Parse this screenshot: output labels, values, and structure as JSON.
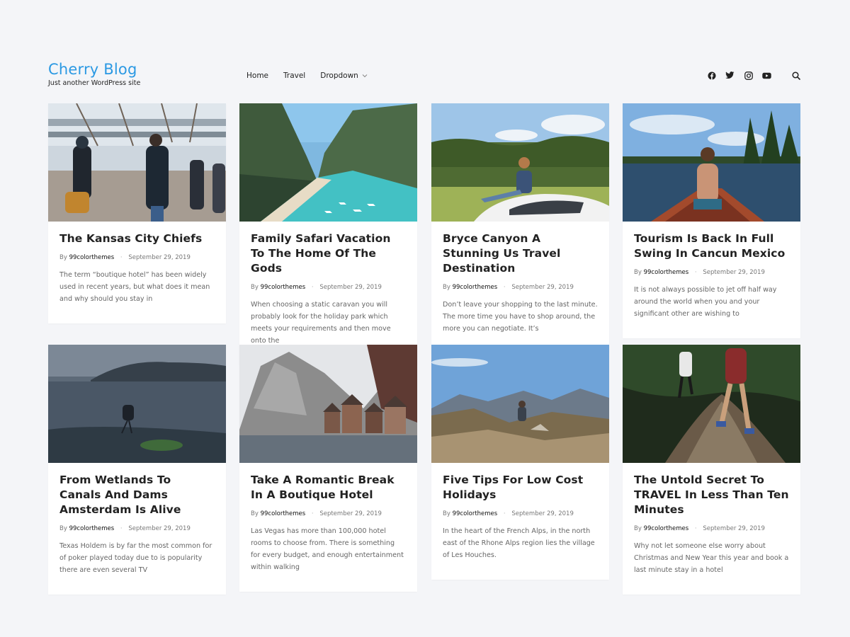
{
  "site": {
    "title": "Cherry Blog",
    "tagline": "Just another WordPress site"
  },
  "nav": {
    "items": [
      "Home",
      "Travel",
      "Dropdown"
    ]
  },
  "social": [
    "facebook-icon",
    "twitter-icon",
    "instagram-icon",
    "youtube-icon",
    "search-icon"
  ],
  "colors": {
    "accent": "#2b99e3",
    "background": "#f4f5f8"
  },
  "posts": [
    {
      "title": "The Kansas City Chiefs",
      "by": "By",
      "author": "99colorthemes",
      "date": "September 29, 2019",
      "excerpt": "The term “boutique hotel” has been widely used in recent years, but what does it mean and why should you stay in"
    },
    {
      "title": "Family Safari Vacation To The Home Of The Gods",
      "by": "By",
      "author": "99colorthemes",
      "date": "September 29, 2019",
      "excerpt": "When choosing a static caravan you will probably look for the holiday park which meets your requirements and then move onto the"
    },
    {
      "title": "Bryce Canyon A Stunning Us Travel Destination",
      "by": "By",
      "author": "99colorthemes",
      "date": "September 29, 2019",
      "excerpt": "Don’t leave your shopping to the last minute. The more time you have to shop around, the more you can negotiate. It’s"
    },
    {
      "title": "Tourism Is Back In Full Swing In Cancun Mexico",
      "by": "By",
      "author": "99colorthemes",
      "date": "September 29, 2019",
      "excerpt": "It is not always possible to jet off half way around the world when you and your significant other are wishing to"
    },
    {
      "title": "From Wetlands To Canals And Dams Amsterdam Is Alive",
      "by": "By",
      "author": "99colorthemes",
      "date": "September 29, 2019",
      "excerpt": "Texas Holdem is by far the most common for of poker played today due to is popularity there are even several TV"
    },
    {
      "title": "Take A Romantic Break In A Boutique Hotel",
      "by": "By",
      "author": "99colorthemes",
      "date": "September 29, 2019",
      "excerpt": "Las Vegas has more than 100,000 hotel rooms to choose from. There is something for every budget, and enough entertainment within walking"
    },
    {
      "title": "Five Tips For Low Cost Holidays",
      "by": "By",
      "author": "99colorthemes",
      "date": "September 29, 2019",
      "excerpt": "In the heart of the French Alps, in the north east of the Rhone Alps region lies the village of Les Houches."
    },
    {
      "title": "The Untold Secret To TRAVEL In Less Than Ten Minutes",
      "by": "By",
      "author": "99colorthemes",
      "date": "September 29, 2019",
      "excerpt": "Why not let someone else worry about Christmas and New Year this year and book a last minute stay in a hotel"
    }
  ]
}
